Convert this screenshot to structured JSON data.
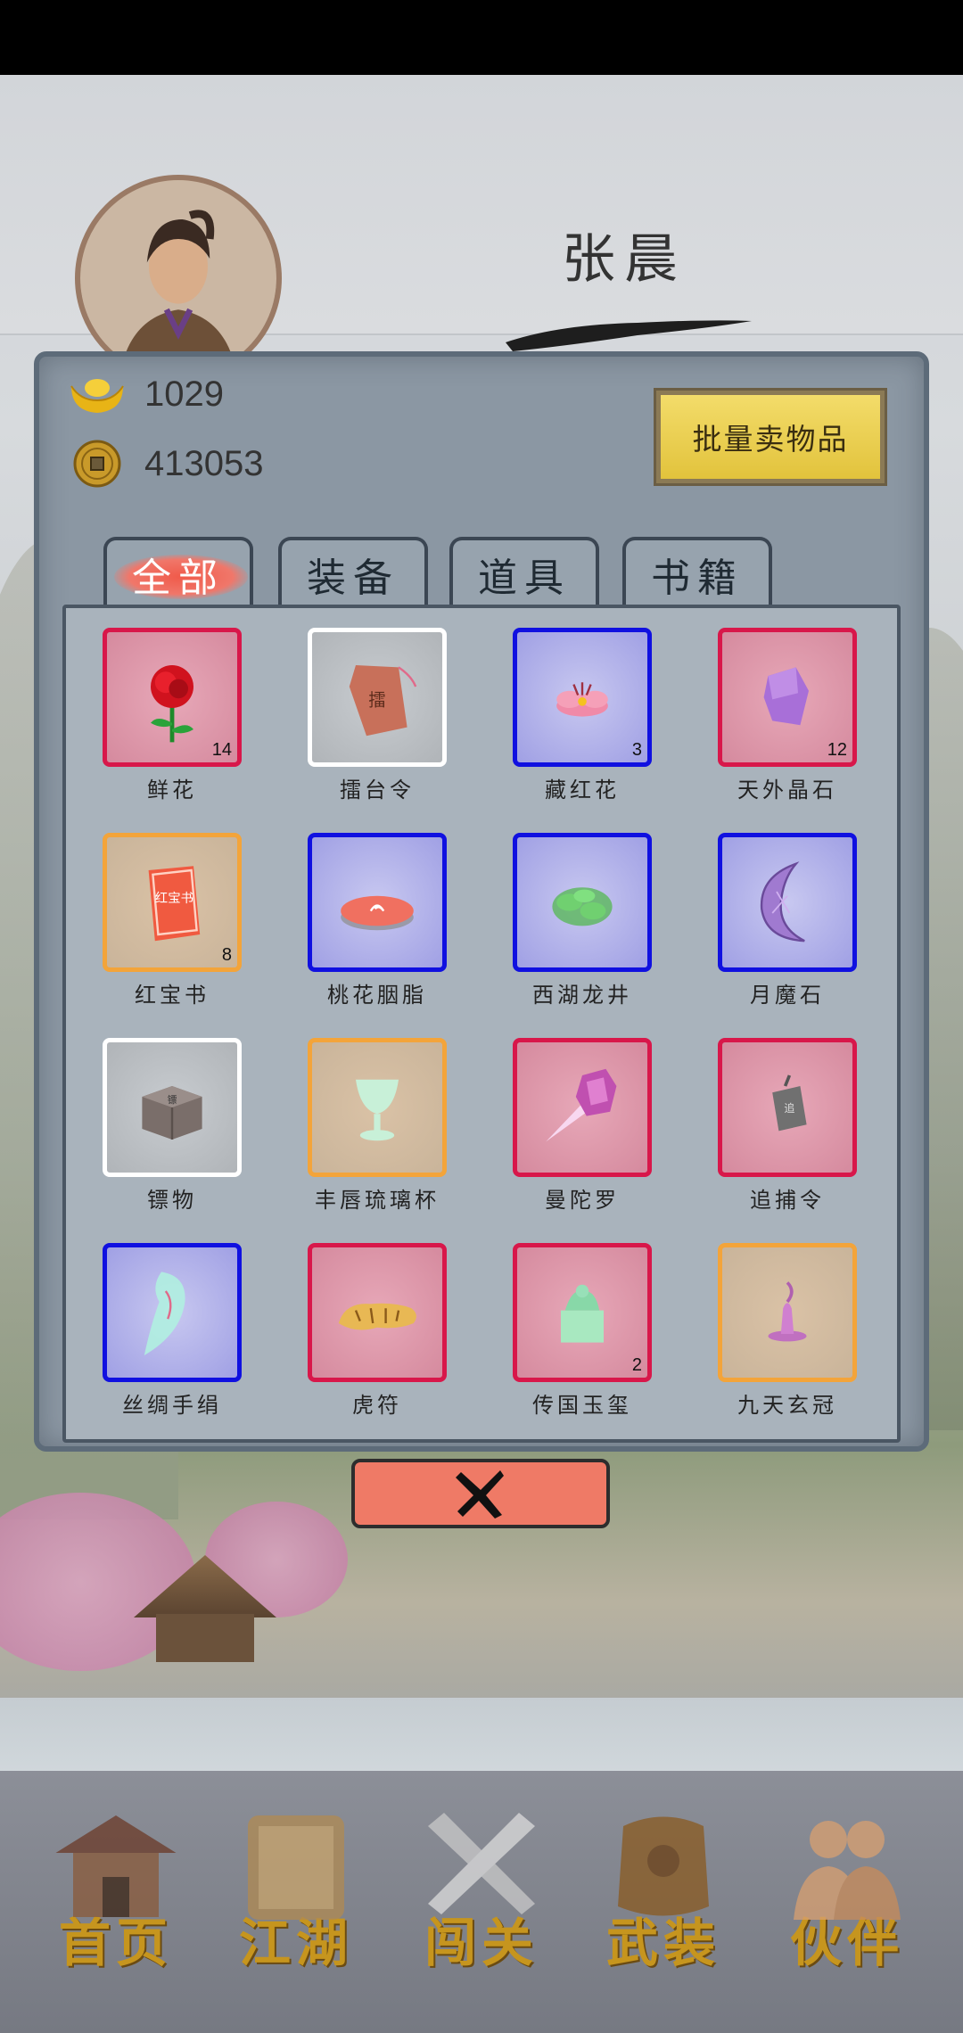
{
  "player": {
    "name": "张晨"
  },
  "currency": {
    "gold_ingot": "1029",
    "copper_coin": "413053"
  },
  "inventory": {
    "bulk_sell_label": "批量卖物品",
    "tabs": [
      {
        "label": "全部",
        "active": true
      },
      {
        "label": "装备",
        "active": false
      },
      {
        "label": "道具",
        "active": false
      },
      {
        "label": "书籍",
        "active": false
      }
    ],
    "items": [
      {
        "name": "鲜花",
        "count": "14",
        "rarity": "red",
        "icon": "rose-icon"
      },
      {
        "name": "擂台令",
        "count": "",
        "rarity": "white",
        "icon": "token-icon"
      },
      {
        "name": "藏红花",
        "count": "3",
        "rarity": "blue",
        "icon": "saffron-icon"
      },
      {
        "name": "天外晶石",
        "count": "12",
        "rarity": "red",
        "icon": "crystal-icon"
      },
      {
        "name": "红宝书",
        "count": "8",
        "rarity": "orange",
        "icon": "red-book-icon"
      },
      {
        "name": "桃花胭脂",
        "count": "",
        "rarity": "blue",
        "icon": "rouge-icon"
      },
      {
        "name": "西湖龙井",
        "count": "",
        "rarity": "blue",
        "icon": "tea-icon"
      },
      {
        "name": "月魔石",
        "count": "",
        "rarity": "blue",
        "icon": "moon-stone-icon"
      },
      {
        "name": "镖物",
        "count": "",
        "rarity": "white",
        "icon": "cargo-box-icon"
      },
      {
        "name": "丰唇琉璃杯",
        "count": "",
        "rarity": "orange",
        "icon": "glass-cup-icon"
      },
      {
        "name": "曼陀罗",
        "count": "",
        "rarity": "red",
        "icon": "datura-icon"
      },
      {
        "name": "追捕令",
        "count": "",
        "rarity": "red",
        "icon": "warrant-icon"
      },
      {
        "name": "丝绸手绢",
        "count": "",
        "rarity": "blue",
        "icon": "silk-handkerchief-icon"
      },
      {
        "name": "虎符",
        "count": "",
        "rarity": "red",
        "icon": "tiger-tally-icon"
      },
      {
        "name": "传国玉玺",
        "count": "2",
        "rarity": "red",
        "icon": "jade-seal-icon"
      },
      {
        "name": "九天玄冠",
        "count": "",
        "rarity": "orange",
        "icon": "crown-icon"
      }
    ],
    "colors": {
      "red": "#d8174a",
      "white": "#ffffff",
      "blue": "#1010e0",
      "orange": "#f3a43a"
    }
  },
  "nav": {
    "items": [
      {
        "label": "首页",
        "icon": "house-icon"
      },
      {
        "label": "江湖",
        "icon": "scroll-icon"
      },
      {
        "label": "闯关",
        "icon": "crossed-swords-icon"
      },
      {
        "label": "武装",
        "icon": "armor-icon"
      },
      {
        "label": "伙伴",
        "icon": "companions-icon"
      }
    ]
  }
}
